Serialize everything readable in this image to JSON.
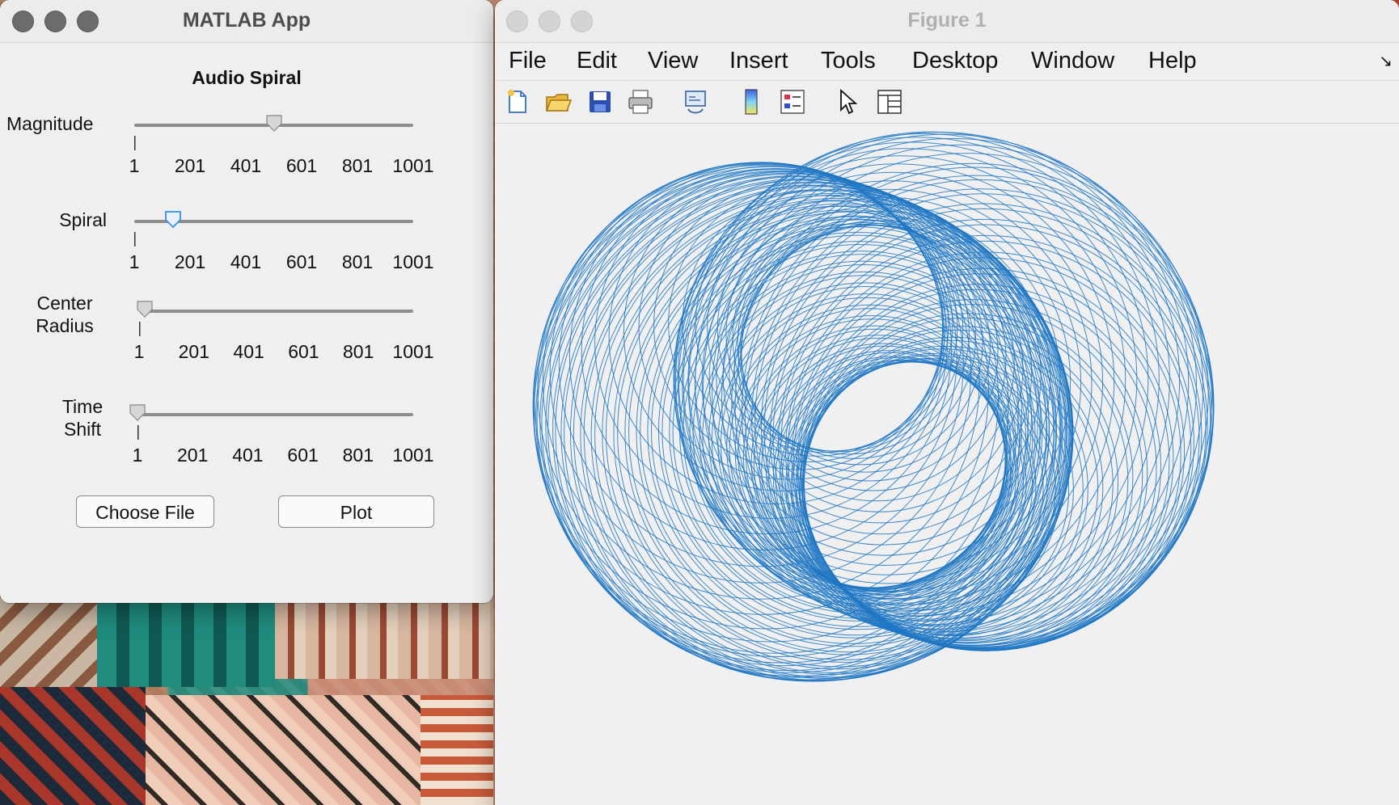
{
  "app_window": {
    "title": "MATLAB App",
    "panel_title": "Audio Spiral",
    "sliders": [
      {
        "label": "Magnitude",
        "value_fraction": 0.5,
        "thumb_color": "#cfcfcf"
      },
      {
        "label": "Spiral",
        "value_fraction": 0.14,
        "thumb_color": "#3a8fe0"
      },
      {
        "label_line1": "Center",
        "label_line2": "Radius",
        "value_fraction": 0.02,
        "thumb_color": "#cfcfcf"
      },
      {
        "label_line1": "Time",
        "label_line2": "Shift",
        "value_fraction": 0.0,
        "thumb_color": "#cfcfcf"
      }
    ],
    "tick_labels": [
      "1",
      "201",
      "401",
      "601",
      "801",
      "1001"
    ],
    "buttons": {
      "choose_file": "Choose File",
      "plot": "Plot"
    }
  },
  "figure_window": {
    "title": "Figure 1",
    "menu": [
      "File",
      "Edit",
      "View",
      "Insert",
      "Tools",
      "Desktop",
      "Window",
      "Help"
    ],
    "toolbar_icons": [
      "new-figure-icon",
      "open-file-icon",
      "save-icon",
      "print-icon",
      "link-plot-icon",
      "colorbar-icon",
      "legend-icon",
      "edit-plot-icon",
      "property-inspector-icon"
    ],
    "plot_color": "#1f77c4"
  },
  "chart_data": {
    "type": "line",
    "description_type": "parametric spiral of overlapping circles",
    "series": [
      {
        "values": []
      }
    ]
  }
}
